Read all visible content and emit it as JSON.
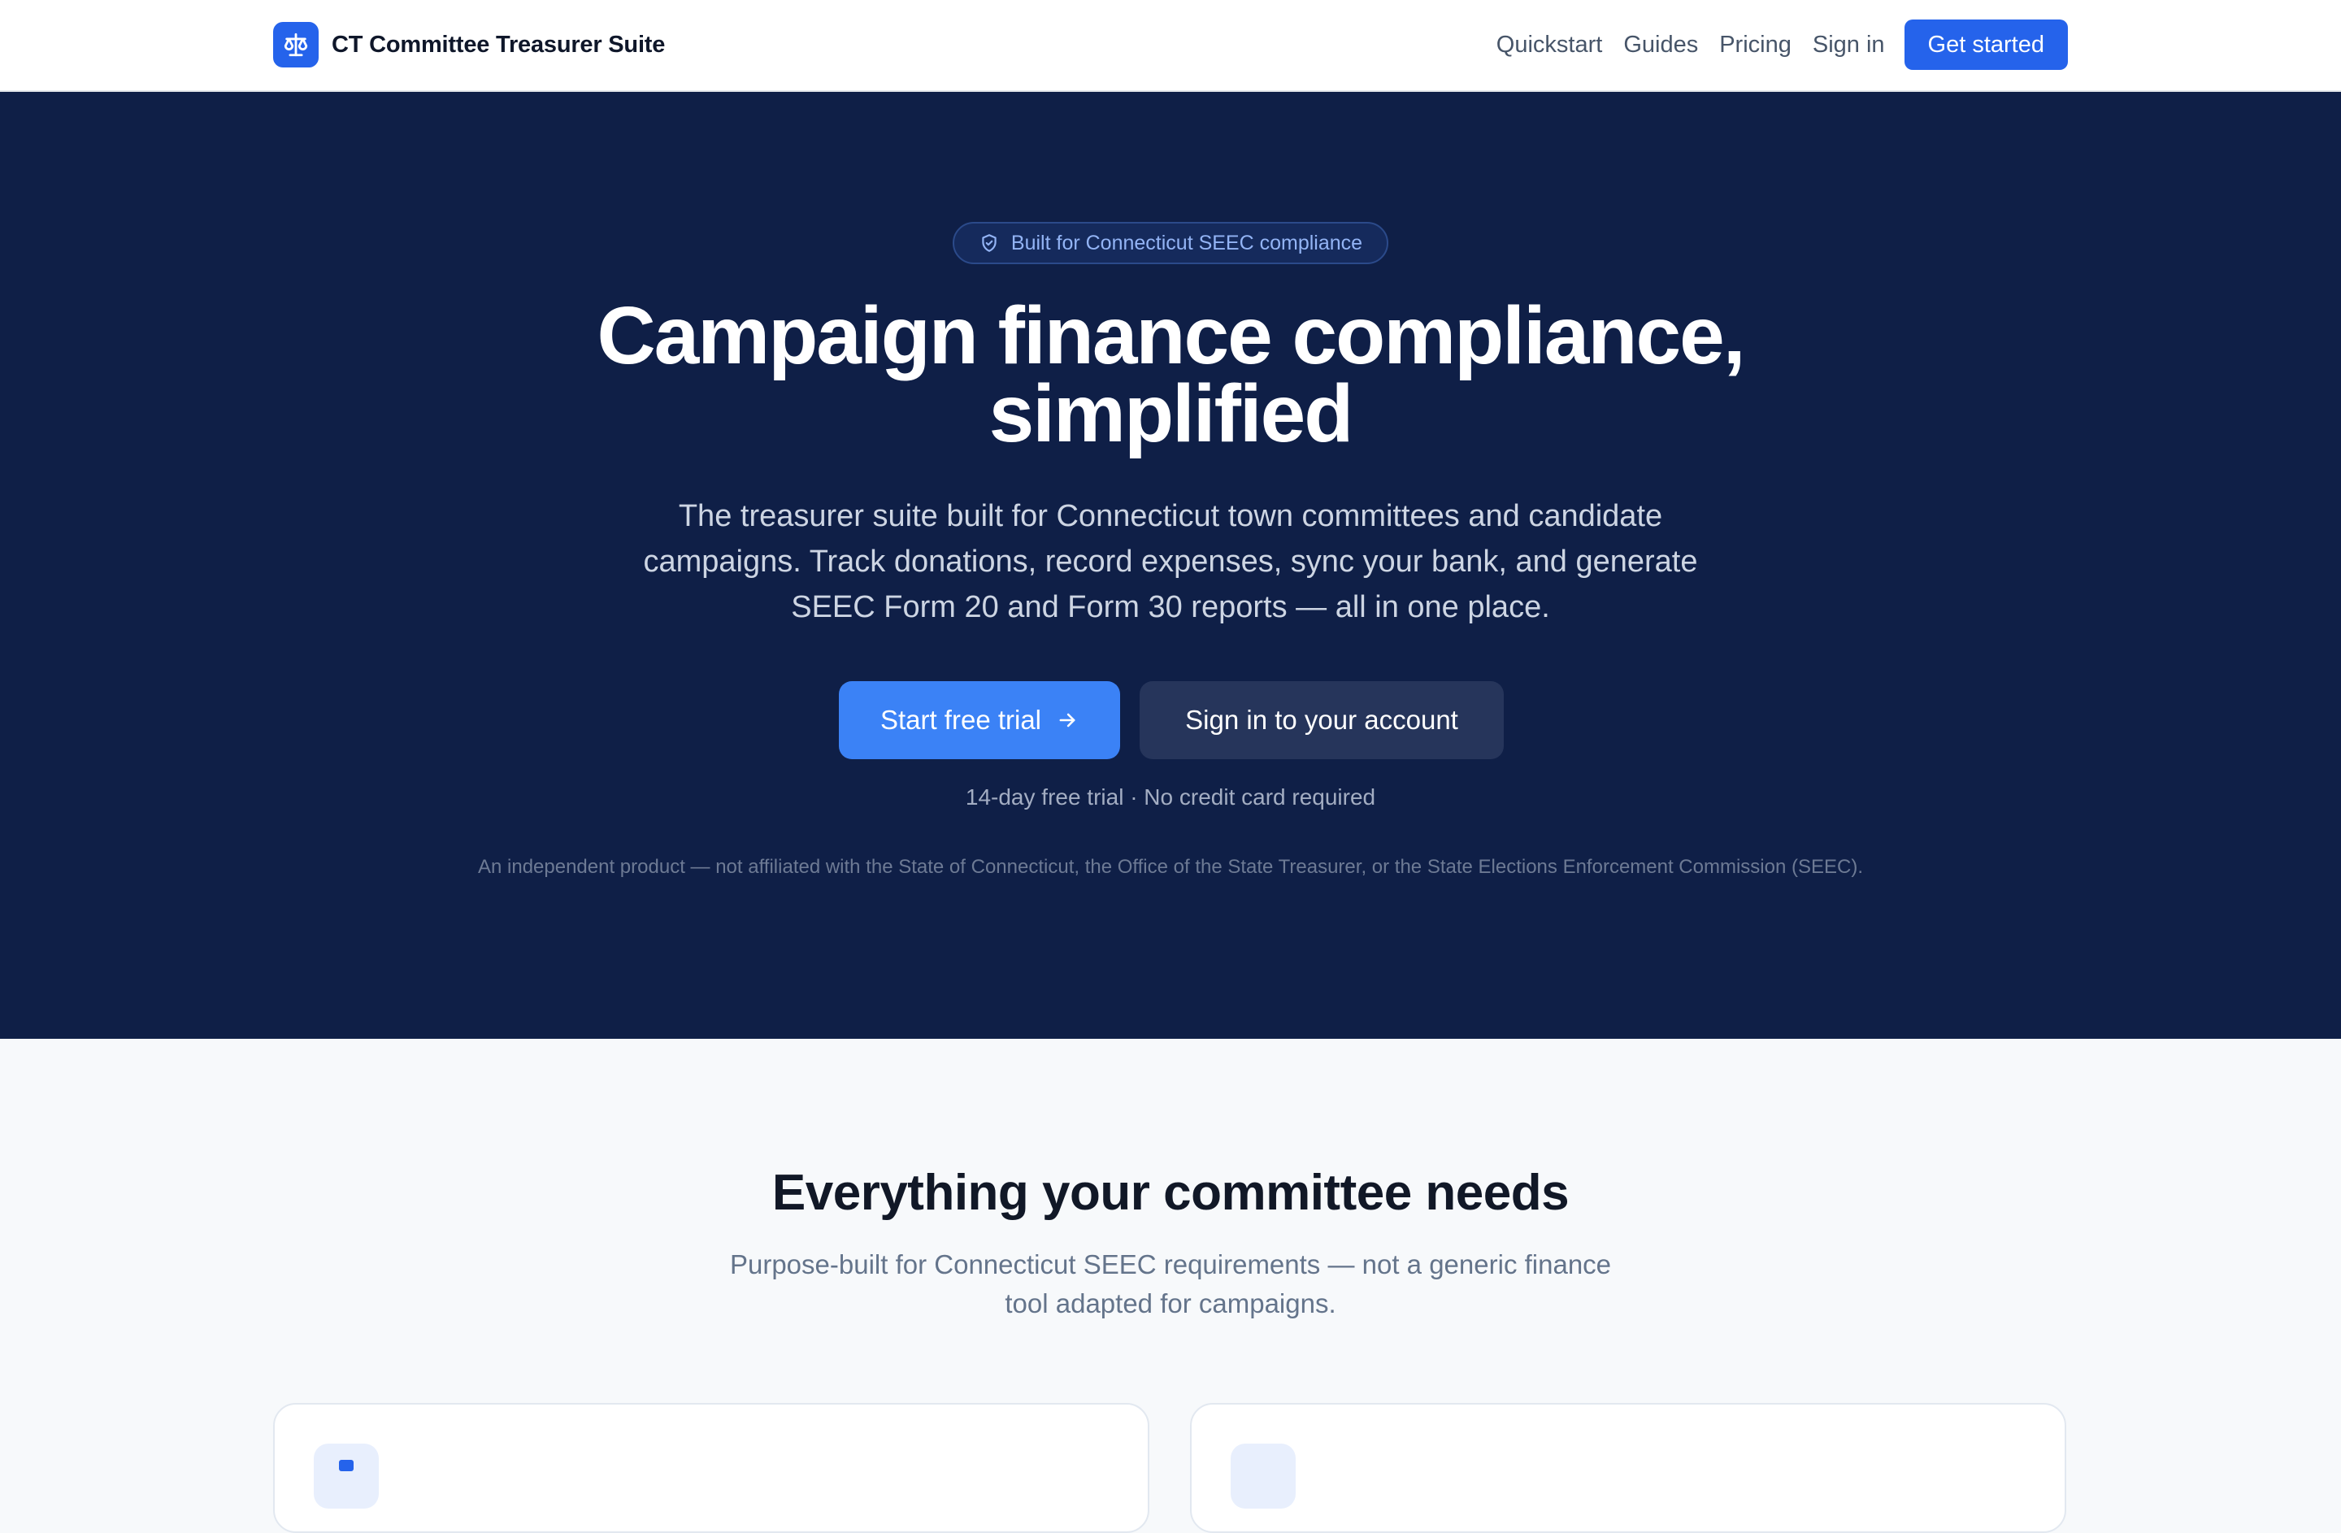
{
  "nav": {
    "brand": "CT Committee Treasurer Suite",
    "brand_icon": "scale-icon",
    "links": [
      "Quickstart",
      "Guides",
      "Pricing",
      "Sign in"
    ],
    "cta": "Get started",
    "accent": "#2563eb"
  },
  "hero": {
    "badge": "Built for Connecticut SEEC compliance",
    "badge_icon": "shield-check-icon",
    "title_line1": "Campaign finance compliance,",
    "title_line2": "simplified",
    "subtitle_line1": "The treasurer suite built for Connecticut town committees and candidate",
    "subtitle_line2": "campaigns. Track donations, record expenses, sync your bank, and generate",
    "subtitle_line3": "SEEC Form 20 and Form 30 reports — all in one place.",
    "primary_button": "Start free trial",
    "primary_icon": "arrow-right-icon",
    "secondary_button": "Sign in to your account",
    "trial_note": "14-day free trial · No credit card required",
    "disclaimer": "An independent product — not affiliated with the State of Connecticut, the Office of the State Treasurer, or the State Elections Enforcement Commission (SEEC).",
    "background": "#0f1f47"
  },
  "features": {
    "title": "Everything your committee needs",
    "subtitle_line1": "Purpose-built for Connecticut SEEC requirements — not a generic finance",
    "subtitle_line2": "tool adapted for campaigns."
  }
}
